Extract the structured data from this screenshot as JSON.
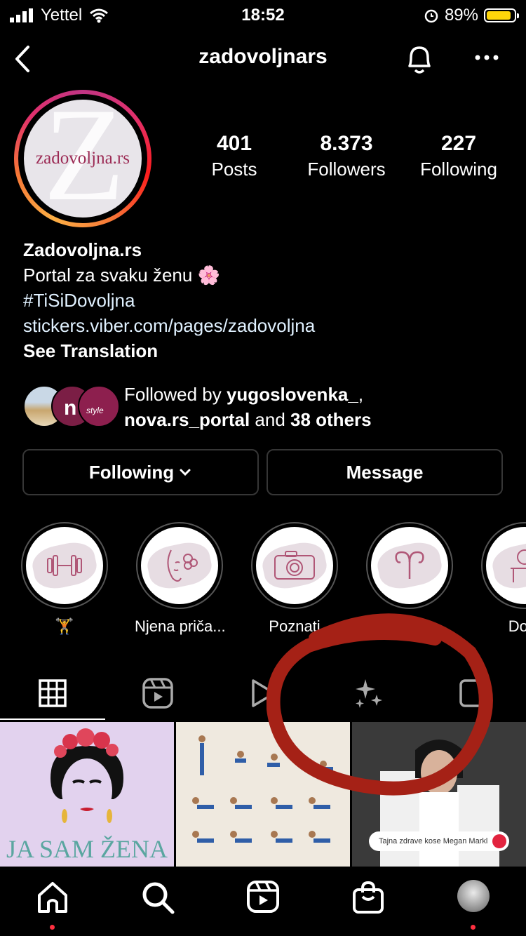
{
  "status_bar": {
    "carrier": "Yettel",
    "time": "18:52",
    "battery": "89%",
    "battery_level": 0.89
  },
  "header": {
    "username": "zadovoljnars"
  },
  "profile": {
    "avatar_text": "zadovoljna.rs",
    "stats": [
      {
        "value": "401",
        "label": "Posts"
      },
      {
        "value": "8.373",
        "label": "Followers"
      },
      {
        "value": "227",
        "label": "Following"
      }
    ],
    "name": "Zadovoljna.rs",
    "bio_line": "Portal za svaku ženu 🌸",
    "hashtag": "#TiSiDovoljna",
    "link": "stickers.viber.com/pages/zadovoljna",
    "see_translation": "See Translation",
    "followed_by": {
      "prefix": "Followed by ",
      "user1": "yugoslovenka_",
      "comma": ",",
      "user2": "nova.rs_portal",
      "and": " and ",
      "others": "38 others"
    }
  },
  "actions": {
    "following": "Following",
    "message": "Message"
  },
  "highlights": [
    {
      "label": "🏋️",
      "icon": "dumbbell-icon"
    },
    {
      "label": "Njena priča...",
      "icon": "face-flower-icon"
    },
    {
      "label": "Poznati",
      "icon": "camera-icon"
    },
    {
      "label": "",
      "icon": "aries-icon"
    },
    {
      "label": "Dom",
      "icon": "vanity-icon"
    }
  ],
  "tabs": [
    "grid-icon",
    "reels-icon",
    "video-icon",
    "sparkles-icon",
    "tagged-icon"
  ],
  "posts": [
    {
      "caption": "JA SAM ŽENA"
    },
    {
      "caption": ""
    },
    {
      "caption": "Tajna zdrave kose Megan Markl"
    }
  ],
  "bottom_nav": [
    "home-icon",
    "search-icon",
    "reels-icon",
    "shop-icon",
    "profile-avatar"
  ],
  "colors": {
    "accent_link": "#e0f1ff",
    "annotation": "#a52116",
    "notification_dot": "#ff3040"
  }
}
